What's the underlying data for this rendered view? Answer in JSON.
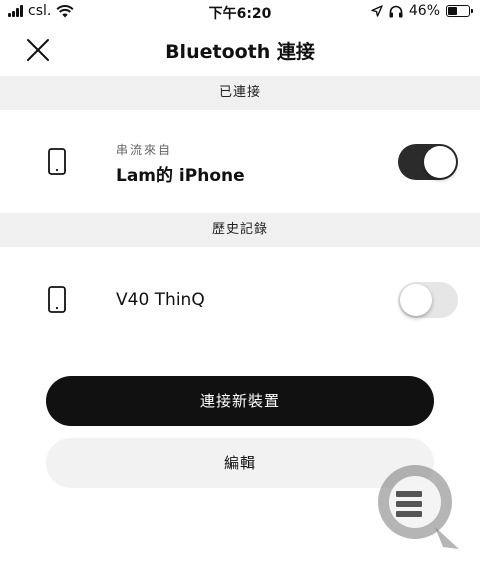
{
  "status_bar": {
    "carrier": "csl.",
    "time": "下午6:20",
    "battery_percent": "46%",
    "battery_level": 0.46
  },
  "header": {
    "title": "Bluetooth 連接"
  },
  "sections": {
    "connected": "已連接",
    "history": "歷史記錄"
  },
  "connected_device": {
    "subtitle": "串流來自",
    "name": "Lam的 iPhone",
    "toggle_on": true
  },
  "history_device": {
    "name": "V40 ThinQ",
    "toggle_on": false
  },
  "buttons": {
    "connect_new": "連接新裝置",
    "edit": "編輯"
  },
  "colors": {
    "toggle_on": "#2b2b2b",
    "primary_button": "#111111",
    "section_bg": "#f0f0f0"
  }
}
